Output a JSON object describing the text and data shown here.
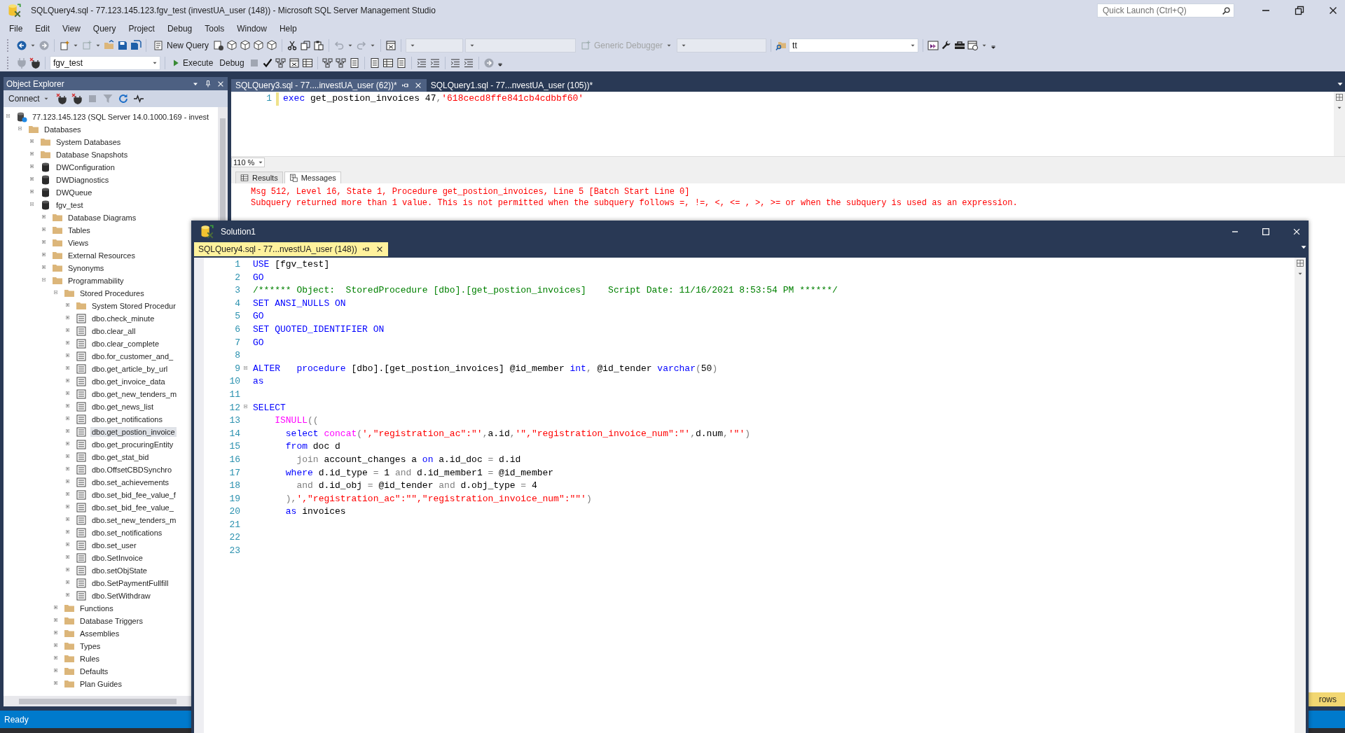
{
  "window": {
    "title": "SQLQuery4.sql - 77.123.145.123.fgv_test (investUA_user (148)) - Microsoft SQL Server Management Studio"
  },
  "quick_launch": {
    "placeholder": "Quick Launch (Ctrl+Q)"
  },
  "menu": [
    "File",
    "Edit",
    "View",
    "Query",
    "Project",
    "Debug",
    "Tools",
    "Window",
    "Help"
  ],
  "toolbar": {
    "new_query": "New Query",
    "generic_debugger": {
      "label": "Generic Debugger",
      "disabled": true
    },
    "find_value": "tt"
  },
  "sql_toolbar": {
    "database": "fgv_test",
    "execute": "Execute",
    "debug": "Debug"
  },
  "object_explorer": {
    "title": "Object Explorer",
    "connect": "Connect",
    "tree": [
      {
        "label": "77.123.145.123 (SQL Server 14.0.1000.169 - invest",
        "kind": "server",
        "expanded": true,
        "selected": false,
        "children": [
          {
            "label": "Databases",
            "kind": "folder",
            "expanded": true,
            "selected": false,
            "children": [
              {
                "label": "System Databases",
                "kind": "folder",
                "expanded": false,
                "selected": false
              },
              {
                "label": "Database Snapshots",
                "kind": "folder",
                "expanded": false,
                "selected": false
              },
              {
                "label": "DWConfiguration",
                "kind": "database",
                "expanded": false,
                "selected": false
              },
              {
                "label": "DWDiagnostics",
                "kind": "database",
                "expanded": false,
                "selected": false
              },
              {
                "label": "DWQueue",
                "kind": "database",
                "expanded": false,
                "selected": false
              },
              {
                "label": "fgv_test",
                "kind": "database",
                "expanded": true,
                "selected": false,
                "children": [
                  {
                    "label": "Database Diagrams",
                    "kind": "folder",
                    "expanded": false,
                    "selected": false
                  },
                  {
                    "label": "Tables",
                    "kind": "folder",
                    "expanded": false,
                    "selected": false
                  },
                  {
                    "label": "Views",
                    "kind": "folder",
                    "expanded": false,
                    "selected": false
                  },
                  {
                    "label": "External Resources",
                    "kind": "folder",
                    "expanded": false,
                    "selected": false
                  },
                  {
                    "label": "Synonyms",
                    "kind": "folder",
                    "expanded": false,
                    "selected": false
                  },
                  {
                    "label": "Programmability",
                    "kind": "folder",
                    "expanded": true,
                    "selected": false,
                    "children": [
                      {
                        "label": "Stored Procedures",
                        "kind": "folder",
                        "expanded": true,
                        "selected": false,
                        "children": [
                          {
                            "label": "System Stored Procedur",
                            "kind": "folder",
                            "expanded": false,
                            "selected": false
                          },
                          {
                            "label": "dbo.check_minute",
                            "kind": "procedure",
                            "expanded": false,
                            "selected": false
                          },
                          {
                            "label": "dbo.clear_all",
                            "kind": "procedure",
                            "expanded": false,
                            "selected": false
                          },
                          {
                            "label": "dbo.clear_complete",
                            "kind": "procedure",
                            "expanded": false,
                            "selected": false
                          },
                          {
                            "label": "dbo.for_customer_and_",
                            "kind": "procedure",
                            "expanded": false,
                            "selected": false
                          },
                          {
                            "label": "dbo.get_article_by_url",
                            "kind": "procedure",
                            "expanded": false,
                            "selected": false
                          },
                          {
                            "label": "dbo.get_invoice_data",
                            "kind": "procedure",
                            "expanded": false,
                            "selected": false
                          },
                          {
                            "label": "dbo.get_new_tenders_m",
                            "kind": "procedure",
                            "expanded": false,
                            "selected": false
                          },
                          {
                            "label": "dbo.get_news_list",
                            "kind": "procedure",
                            "expanded": false,
                            "selected": false
                          },
                          {
                            "label": "dbo.get_notifications",
                            "kind": "procedure",
                            "expanded": false,
                            "selected": false
                          },
                          {
                            "label": "dbo.get_postion_invoice",
                            "kind": "procedure",
                            "expanded": false,
                            "selected": true
                          },
                          {
                            "label": "dbo.get_procuringEntity",
                            "kind": "procedure",
                            "expanded": false,
                            "selected": false
                          },
                          {
                            "label": "dbo.get_stat_bid",
                            "kind": "procedure",
                            "expanded": false,
                            "selected": false
                          },
                          {
                            "label": "dbo.OffsetCBDSynchro",
                            "kind": "procedure",
                            "expanded": false,
                            "selected": false
                          },
                          {
                            "label": "dbo.set_achievements",
                            "kind": "procedure",
                            "expanded": false,
                            "selected": false
                          },
                          {
                            "label": "dbo.set_bid_fee_value_f",
                            "kind": "procedure",
                            "expanded": false,
                            "selected": false
                          },
                          {
                            "label": "dbo.set_bid_fee_value_",
                            "kind": "procedure",
                            "expanded": false,
                            "selected": false
                          },
                          {
                            "label": "dbo.set_new_tenders_m",
                            "kind": "procedure",
                            "expanded": false,
                            "selected": false
                          },
                          {
                            "label": "dbo.set_notifications",
                            "kind": "procedure",
                            "expanded": false,
                            "selected": false
                          },
                          {
                            "label": "dbo.set_user",
                            "kind": "procedure",
                            "expanded": false,
                            "selected": false
                          },
                          {
                            "label": "dbo.SetInvoice",
                            "kind": "procedure",
                            "expanded": false,
                            "selected": false
                          },
                          {
                            "label": "dbo.setObjState",
                            "kind": "procedure",
                            "expanded": false,
                            "selected": false
                          },
                          {
                            "label": "dbo.SetPaymentFullfill",
                            "kind": "procedure",
                            "expanded": false,
                            "selected": false
                          },
                          {
                            "label": "dbo.SetWithdraw",
                            "kind": "procedure",
                            "expanded": false,
                            "selected": false
                          }
                        ]
                      },
                      {
                        "label": "Functions",
                        "kind": "folder",
                        "expanded": false,
                        "selected": false
                      },
                      {
                        "label": "Database Triggers",
                        "kind": "folder",
                        "expanded": false,
                        "selected": false
                      },
                      {
                        "label": "Assemblies",
                        "kind": "folder",
                        "expanded": false,
                        "selected": false
                      },
                      {
                        "label": "Types",
                        "kind": "folder",
                        "expanded": false,
                        "selected": false
                      },
                      {
                        "label": "Rules",
                        "kind": "folder",
                        "expanded": false,
                        "selected": false
                      },
                      {
                        "label": "Defaults",
                        "kind": "folder",
                        "expanded": false,
                        "selected": false
                      },
                      {
                        "label": "Plan Guides",
                        "kind": "folder",
                        "expanded": false,
                        "selected": false
                      }
                    ]
                  }
                ]
              }
            ]
          }
        ]
      }
    ]
  },
  "editor_tabs": [
    {
      "label": "SQLQuery3.sql - 77....investUA_user (62))*",
      "selected": true
    },
    {
      "label": "SQLQuery1.sql - 77...nvestUA_user (105))*",
      "selected": false
    }
  ],
  "editor": {
    "lines": [
      {
        "number": "1",
        "modified": true,
        "tokens": [
          {
            "kind": "keyword",
            "text": "exec"
          },
          {
            "kind": "plain",
            "text": " get_postion_invoices 47"
          },
          {
            "kind": "operator",
            "text": ","
          },
          {
            "kind": "string",
            "text": "'618cecd8ffe841cb4cdbbf60'"
          }
        ]
      }
    ]
  },
  "zoom": "110 %",
  "result_tabs": [
    {
      "label": "Results",
      "kind": "grid",
      "selected": false
    },
    {
      "label": "Messages",
      "kind": "messages",
      "selected": true
    }
  ],
  "messages": [
    "Msg 512, Level 16, State 1, Procedure get_postion_invoices, Line 5 [Batch Start Line 0]",
    "Subquery returned more than 1 value. This is not permitted when the subquery follows =, !=, <, <= , >, >= or when the subquery is used as an expression."
  ],
  "solution_window": {
    "title": "Solution1",
    "tab": "SQLQuery4.sql - 77...nvestUA_user (148))",
    "lines": [
      {
        "number": "1",
        "foldable": false,
        "tokens": [
          {
            "kind": "keyword",
            "text": "USE"
          },
          {
            "kind": "plain",
            "text": " [fgv_test]"
          }
        ]
      },
      {
        "number": "2",
        "foldable": false,
        "tokens": [
          {
            "kind": "keyword",
            "text": "GO"
          }
        ]
      },
      {
        "number": "3",
        "foldable": false,
        "tokens": [
          {
            "kind": "comment",
            "text": "/****** Object:  StoredProcedure [dbo].[get_postion_invoices]    Script Date: 11/16/2021 8:53:54 PM ******/"
          }
        ]
      },
      {
        "number": "4",
        "foldable": false,
        "tokens": [
          {
            "kind": "keyword",
            "text": "SET ANSI_NULLS ON"
          }
        ]
      },
      {
        "number": "5",
        "foldable": false,
        "tokens": [
          {
            "kind": "keyword",
            "text": "GO"
          }
        ]
      },
      {
        "number": "6",
        "foldable": false,
        "tokens": [
          {
            "kind": "keyword",
            "text": "SET QUOTED_IDENTIFIER ON"
          }
        ]
      },
      {
        "number": "7",
        "foldable": false,
        "tokens": [
          {
            "kind": "keyword",
            "text": "GO"
          }
        ]
      },
      {
        "number": "8",
        "foldable": false
      },
      {
        "number": "9",
        "foldable": true,
        "tokens": [
          {
            "kind": "keyword",
            "text": "ALTER"
          },
          {
            "kind": "keyword",
            "text": "   procedure"
          },
          {
            "kind": "plain",
            "text": " [dbo].[get_postion_invoices] @id_member "
          },
          {
            "kind": "keyword",
            "text": "int"
          },
          {
            "kind": "operator",
            "text": ","
          },
          {
            "kind": "plain",
            "text": " @id_tender "
          },
          {
            "kind": "keyword",
            "text": "varchar"
          },
          {
            "kind": "operator",
            "text": "("
          },
          {
            "kind": "plain",
            "text": "50"
          },
          {
            "kind": "operator",
            "text": ")"
          }
        ]
      },
      {
        "number": "10",
        "foldable": false,
        "tokens": [
          {
            "kind": "keyword",
            "text": "as"
          }
        ]
      },
      {
        "number": "11",
        "foldable": false
      },
      {
        "number": "12",
        "foldable": true,
        "tokens": [
          {
            "kind": "keyword",
            "text": "SELECT"
          }
        ]
      },
      {
        "number": "13",
        "foldable": false,
        "tokens": [
          {
            "kind": "function",
            "text": "    ISNULL"
          },
          {
            "kind": "operator",
            "text": "(("
          }
        ]
      },
      {
        "number": "14",
        "foldable": false,
        "tokens": [
          {
            "kind": "keyword",
            "text": "      select "
          },
          {
            "kind": "function",
            "text": "concat"
          },
          {
            "kind": "operator",
            "text": "("
          },
          {
            "kind": "string",
            "text": "',\"registration_ac\":\"'"
          },
          {
            "kind": "operator",
            "text": ","
          },
          {
            "kind": "plain",
            "text": "a.id"
          },
          {
            "kind": "operator",
            "text": ","
          },
          {
            "kind": "string",
            "text": "'\",\"registration_invoice_num\":\"'"
          },
          {
            "kind": "operator",
            "text": ","
          },
          {
            "kind": "plain",
            "text": "d.num"
          },
          {
            "kind": "operator",
            "text": ","
          },
          {
            "kind": "string",
            "text": "'\"'"
          },
          {
            "kind": "operator",
            "text": ")"
          }
        ]
      },
      {
        "number": "15",
        "foldable": false,
        "tokens": [
          {
            "kind": "keyword",
            "text": "      from"
          },
          {
            "kind": "plain",
            "text": " doc d"
          }
        ]
      },
      {
        "number": "16",
        "foldable": false,
        "tokens": [
          {
            "kind": "operator",
            "text": "        join"
          },
          {
            "kind": "plain",
            "text": " account_changes a "
          },
          {
            "kind": "keyword",
            "text": "on"
          },
          {
            "kind": "plain",
            "text": " a.id_doc "
          },
          {
            "kind": "operator",
            "text": "="
          },
          {
            "kind": "plain",
            "text": " d.id"
          }
        ]
      },
      {
        "number": "17",
        "foldable": false,
        "tokens": [
          {
            "kind": "keyword",
            "text": "      where"
          },
          {
            "kind": "plain",
            "text": " d.id_type "
          },
          {
            "kind": "operator",
            "text": "="
          },
          {
            "kind": "plain",
            "text": " 1 "
          },
          {
            "kind": "operator",
            "text": "and"
          },
          {
            "kind": "plain",
            "text": " d.id_member1 "
          },
          {
            "kind": "operator",
            "text": "="
          },
          {
            "kind": "plain",
            "text": " @id_member"
          }
        ]
      },
      {
        "number": "18",
        "foldable": false,
        "tokens": [
          {
            "kind": "operator",
            "text": "        and"
          },
          {
            "kind": "plain",
            "text": " d.id_obj "
          },
          {
            "kind": "operator",
            "text": "="
          },
          {
            "kind": "plain",
            "text": " @id_tender "
          },
          {
            "kind": "operator",
            "text": "and"
          },
          {
            "kind": "plain",
            "text": " d.obj_type "
          },
          {
            "kind": "operator",
            "text": "="
          },
          {
            "kind": "plain",
            "text": " 4"
          }
        ]
      },
      {
        "number": "19",
        "foldable": false,
        "tokens": [
          {
            "kind": "operator",
            "text": "      ),"
          },
          {
            "kind": "string",
            "text": "',\"registration_ac\":\"\",\"registration_invoice_num\":\"\"'"
          },
          {
            "kind": "operator",
            "text": ")"
          }
        ]
      },
      {
        "number": "20",
        "foldable": false,
        "tokens": [
          {
            "kind": "keyword",
            "text": "      as"
          },
          {
            "kind": "plain",
            "text": " invoices"
          }
        ]
      },
      {
        "number": "21",
        "foldable": false
      },
      {
        "number": "22",
        "foldable": false
      },
      {
        "number": "23",
        "foldable": false
      }
    ]
  },
  "status_bar": {
    "text": "Ready",
    "rows": "rows"
  }
}
